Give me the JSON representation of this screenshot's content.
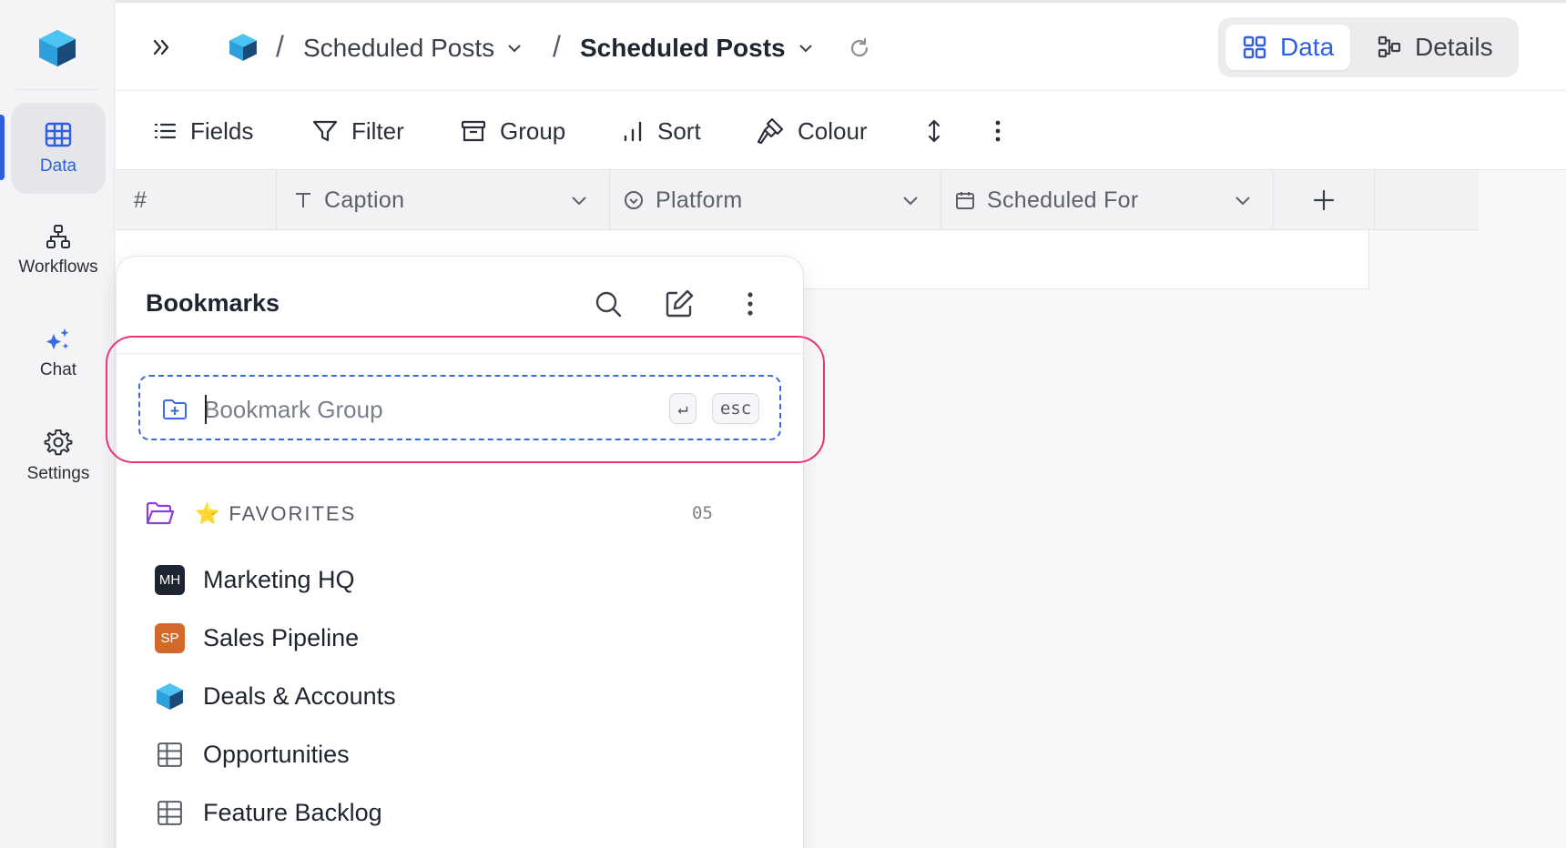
{
  "breadcrumb": {
    "base_name": "Scheduled Posts",
    "table_name": "Scheduled Posts",
    "separator": "/"
  },
  "view_toggle": {
    "data_label": "Data",
    "details_label": "Details"
  },
  "rail": {
    "items": [
      {
        "label": "Data",
        "icon": "grid-icon"
      },
      {
        "label": "Workflows",
        "icon": "workflow-icon"
      },
      {
        "label": "Chat",
        "icon": "sparkles-icon"
      },
      {
        "label": "Settings",
        "icon": "gear-icon"
      }
    ]
  },
  "toolbar": {
    "fields": "Fields",
    "filter": "Filter",
    "group": "Group",
    "sort": "Sort",
    "colour": "Colour"
  },
  "grid": {
    "columns": [
      {
        "name": "#"
      },
      {
        "name": "Caption",
        "icon": "text-icon"
      },
      {
        "name": "Platform",
        "icon": "select-icon"
      },
      {
        "name": "Scheduled For",
        "icon": "calendar-icon"
      }
    ]
  },
  "bookmarks": {
    "title": "Bookmarks",
    "new_group_placeholder": "Bookmark Group",
    "new_group_value": "",
    "enter_key": "↵",
    "esc_key": "esc",
    "favorites": {
      "title": "FAVORITES",
      "emoji": "⭐",
      "count": "05",
      "items": [
        {
          "label": "Marketing HQ",
          "badge": "MH",
          "badge_color": "#1f2433"
        },
        {
          "label": "Sales Pipeline",
          "badge": "SP",
          "badge_color": "#d2692a"
        },
        {
          "label": "Deals & Accounts",
          "icon": "base-logo-icon"
        },
        {
          "label": "Opportunities",
          "icon": "table-icon"
        },
        {
          "label": "Feature Backlog",
          "icon": "table-icon"
        }
      ]
    }
  },
  "colors": {
    "accent": "#2f5fe0",
    "highlight": "#e8357a",
    "folder": "#8a3fe0"
  }
}
